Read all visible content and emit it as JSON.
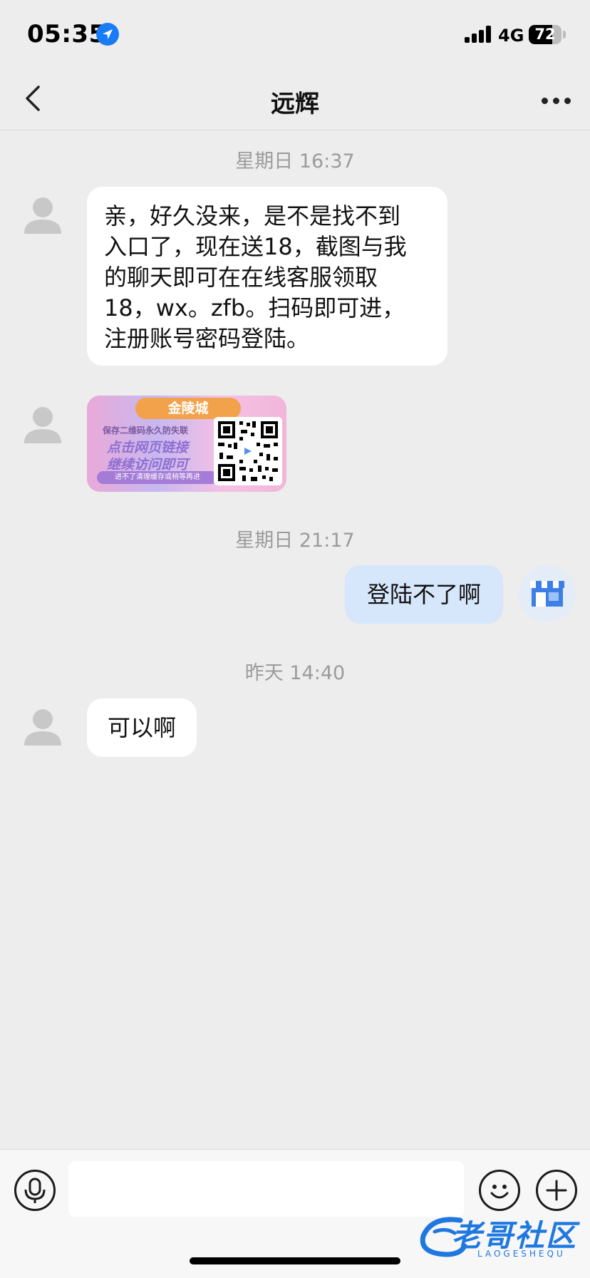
{
  "status_bar": {
    "time": "05:35",
    "network": "4G",
    "battery_percent": 72,
    "battery_label": "72",
    "signal_bars": 4
  },
  "nav": {
    "title": "远辉"
  },
  "messages": {
    "ts1": "星期日 16:37",
    "msg1": [
      "亲，好久没来，是不是找不到",
      "入口了，现在送18，截图与我",
      "的聊天即可在在线客服领取",
      "18，wx。zfb。扫码即可进，",
      "注册账号密码登陆。"
    ],
    "image": {
      "banner": "金陵城",
      "line1": "保存二维码永久防失联",
      "line2": "点击网页链接",
      "line3": "继续访问即可",
      "footer": "进不了清理缓存或稍等再进"
    },
    "ts2": "星期日 21:17",
    "msg2": "登陆不了啊",
    "ts3": "昨天 14:40",
    "msg3": "可以啊"
  },
  "input": {
    "value": "",
    "placeholder": ""
  },
  "watermark": {
    "text": "老哥社区",
    "sub": "LAOGESHEQU"
  },
  "colors": {
    "background": "#ededed",
    "my_bubble": "#d6e6fb",
    "their_bubble": "#ffffff",
    "accent": "#1a7cf5"
  },
  "icons": [
    "location-arrow-icon",
    "signal-icon",
    "battery-icon",
    "back-chevron-icon",
    "more-dots-icon",
    "default-avatar-icon",
    "shop-avatar-icon",
    "microphone-icon",
    "emoji-icon",
    "plus-icon"
  ]
}
